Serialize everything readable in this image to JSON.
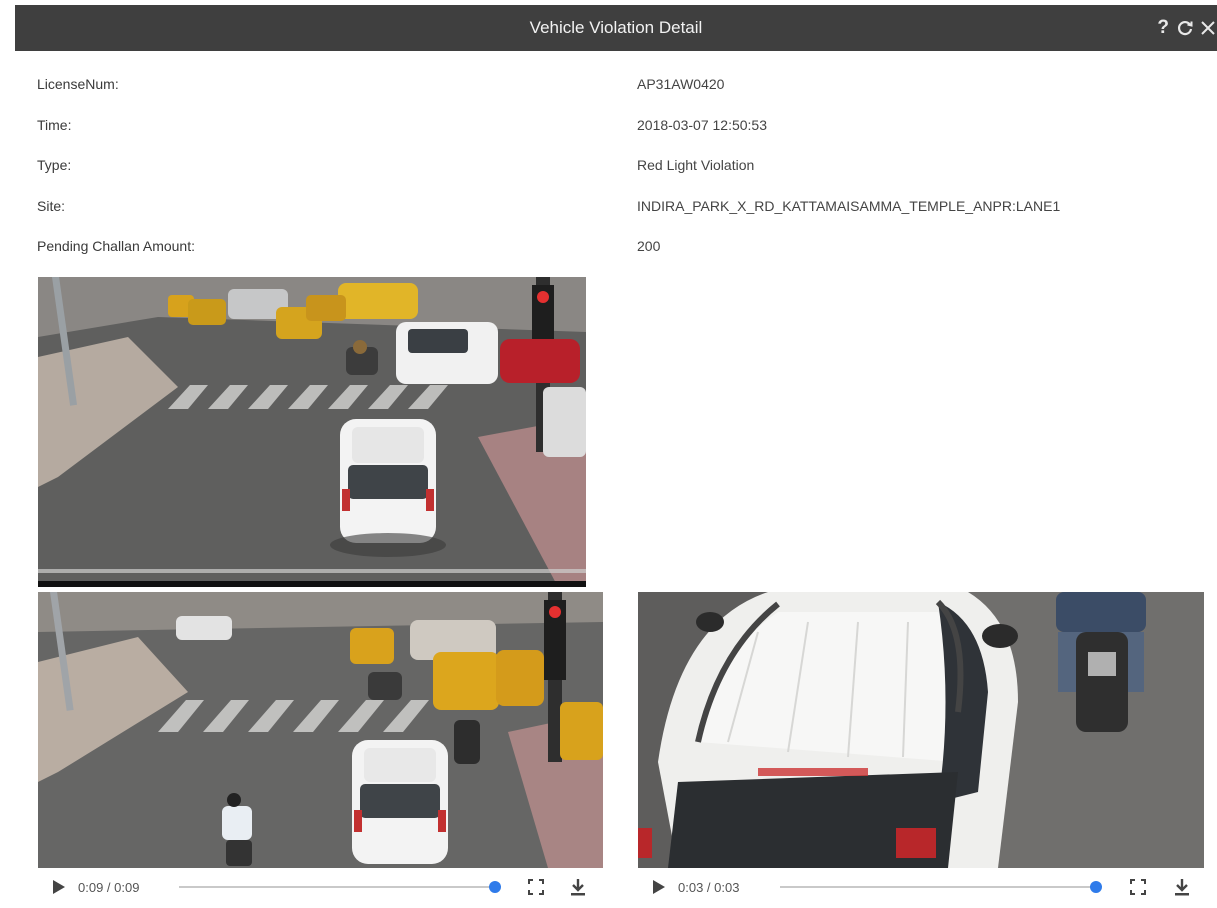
{
  "window": {
    "title": "Vehicle Violation Detail",
    "help_glyph": "?",
    "icons": [
      "help-icon",
      "refresh-icon",
      "close-icon"
    ]
  },
  "details": [
    {
      "label": "LicenseNum:",
      "value": "AP31AW0420"
    },
    {
      "label": "Time:",
      "value": "2018-03-07 12:50:53"
    },
    {
      "label": "Type:",
      "value": "Red Light Violation"
    },
    {
      "label": "Site:",
      "value": "INDIRA_PARK_X_RD_KATTAMAISAMMA_TEMPLE_ANPR:LANE1"
    },
    {
      "label": "Pending Challan Amount:",
      "value": "200"
    }
  ],
  "images": {
    "snapshot": "Intersection snapshot: white SUV crossing at red signal",
    "overview_video": "Intersection overview video frame",
    "closeup_video": "Close-up video frame of white SUV"
  },
  "players": [
    {
      "time": "0:09 / 0:09",
      "progress": 1.0
    },
    {
      "time": "0:03 / 0:03",
      "progress": 1.0
    }
  ],
  "colors": {
    "titlebar": "#3f3f3f",
    "seek_thumb": "#2f7bea"
  }
}
